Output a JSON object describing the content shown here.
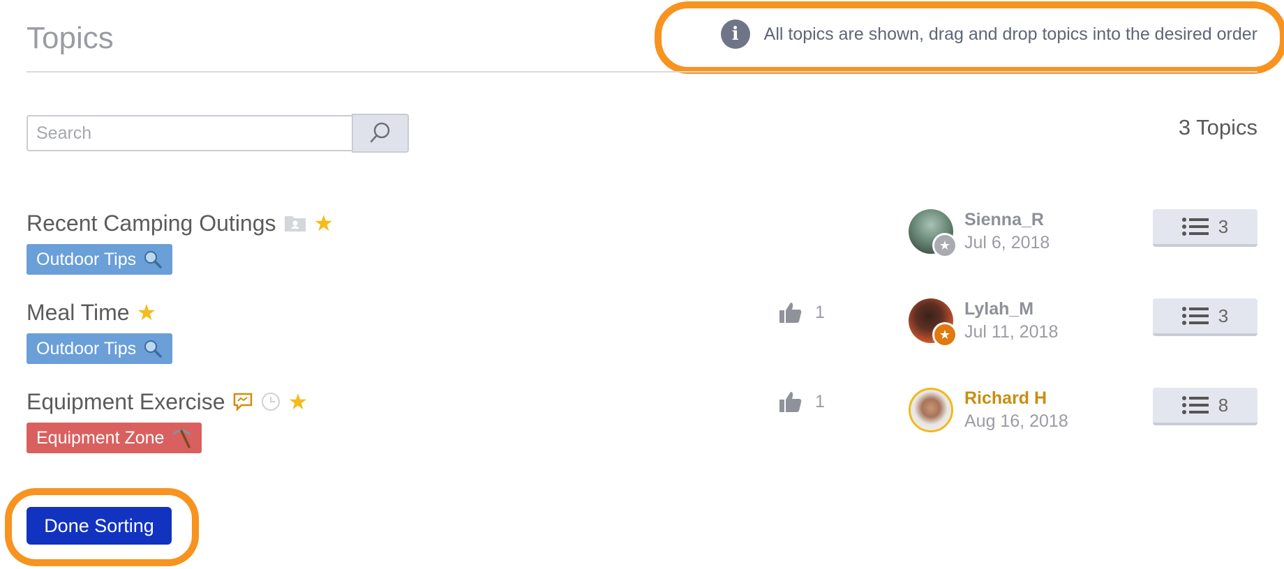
{
  "page": {
    "title": "Topics",
    "info_message": "All topics are shown, drag and drop topics into the desired order",
    "topic_count_label": "3 Topics"
  },
  "search": {
    "placeholder": "Search"
  },
  "topics": [
    {
      "title": "Recent Camping Outings",
      "tag": "Outdoor Tips",
      "tag_color": "#6a9fd8",
      "likes": "",
      "author": "Sienna_R",
      "date": "Jul 6, 2018",
      "replies": "3"
    },
    {
      "title": "Meal Time",
      "tag": "Outdoor Tips",
      "tag_color": "#6a9fd8",
      "likes": "1",
      "author": "Lylah_M",
      "date": "Jul 11, 2018",
      "replies": "3"
    },
    {
      "title": "Equipment Exercise",
      "tag": "Equipment Zone",
      "tag_color": "#d9605f",
      "likes": "1",
      "author": "Richard H",
      "date": "Aug 16, 2018",
      "replies": "8"
    }
  ],
  "footer": {
    "done_label": "Done Sorting"
  },
  "colors": {
    "accent": "#1133c0",
    "highlight": "#f7931e",
    "star": "#f5bb1b",
    "author_highlight": "#c88d11"
  }
}
